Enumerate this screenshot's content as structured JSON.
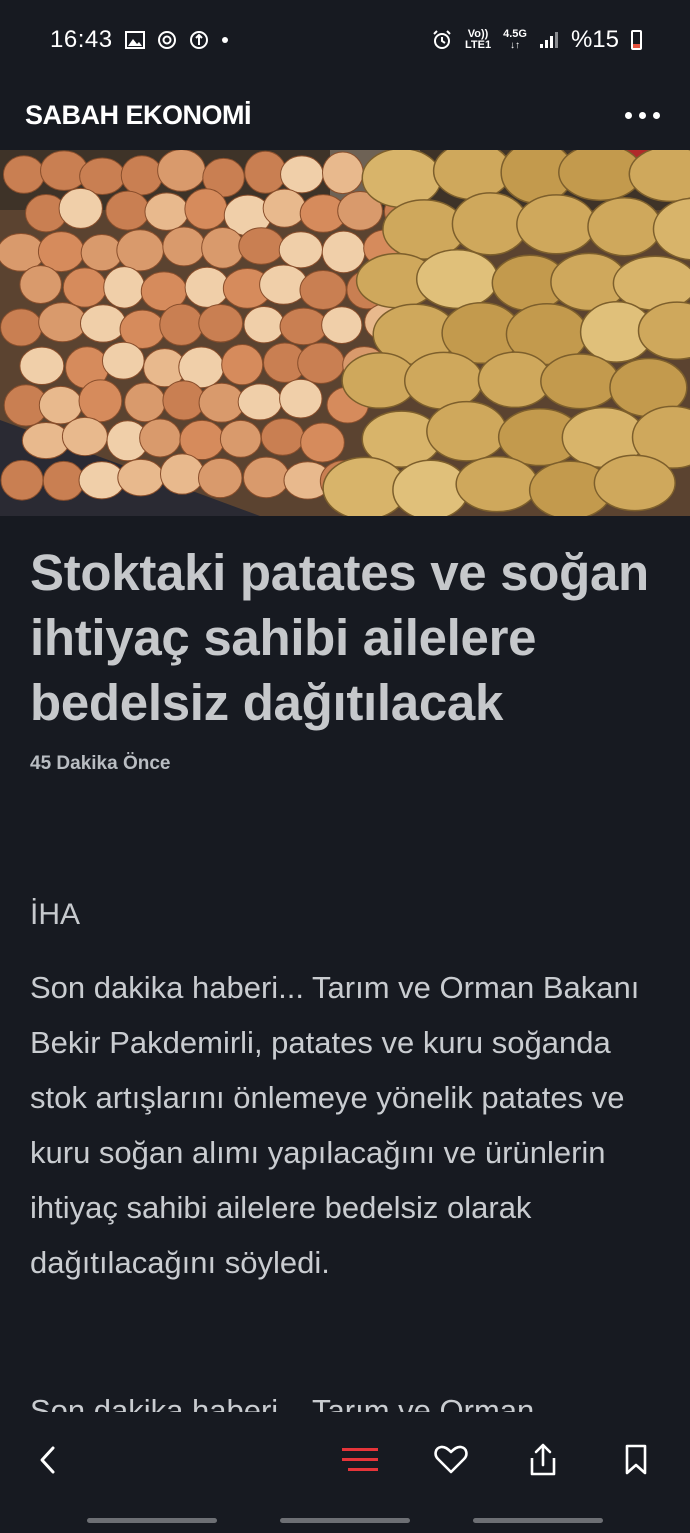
{
  "status_bar": {
    "time": "16:43",
    "network_top": "Vo))",
    "network_bottom": "LTE1",
    "network_type": "4.5G",
    "battery": "%15",
    "icons": [
      "image-icon",
      "activity-icon",
      "vpn-icon",
      "dot-icon",
      "alarm-icon",
      "signal-icon",
      "battery-icon"
    ]
  },
  "app_bar": {
    "title": "SABAH EKONOMİ",
    "menu_icon": "more-vert-icon"
  },
  "article": {
    "title": "Stoktaki patates ve soğan ihtiyaç sahibi ailelere bedelsiz dağıtılacak",
    "time_ago": "45 Dakika Önce",
    "source": "İHA",
    "paragraph_1": "Son dakika haberi... Tarım ve Orman Bakanı Bekir Pakdemirli, patates ve kuru soğanda stok artışlarını önlemeye yönelik patates ve kuru soğan alımı yapılacağını ve ürünlerin ihtiyaç sahibi ailelere bedelsiz olarak dağıtılacağını söyledi.",
    "paragraph_2_partial": "Son dakika haberi... Tarım ve Orman"
  },
  "bottom_nav": {
    "items": [
      "back-icon",
      "menu-lines-icon",
      "heart-icon",
      "share-icon",
      "bookmark-icon"
    ],
    "accent_color": "#e5353a"
  },
  "colors": {
    "background": "#171a21",
    "text": "#c6c8cb",
    "accent": "#e5353a"
  }
}
